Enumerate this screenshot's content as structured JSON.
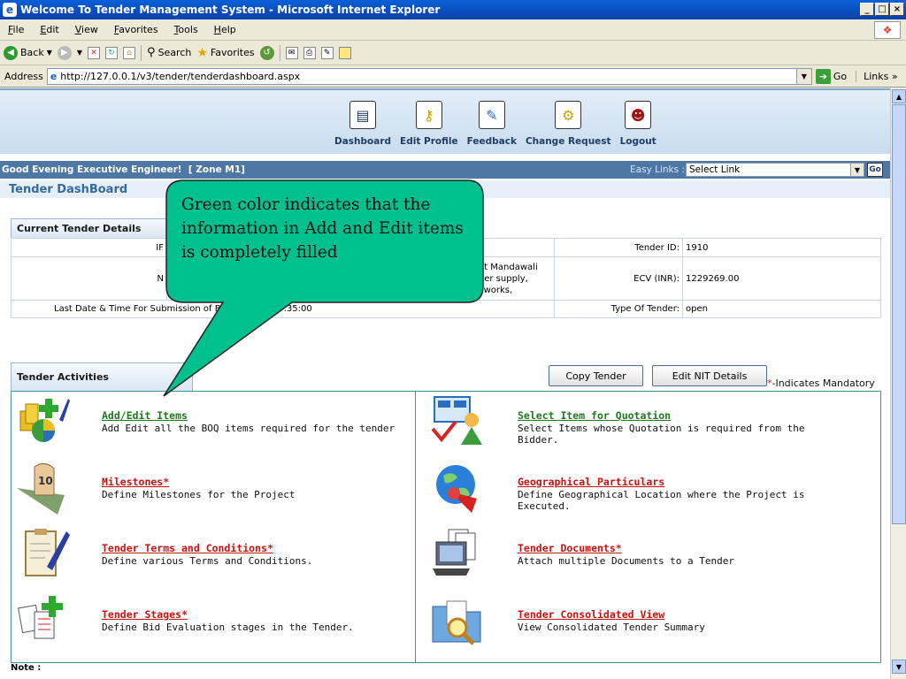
{
  "window": {
    "title": "Welcome To Tender Management System - Microsoft Internet Explorer",
    "controls": [
      "_",
      "□",
      "×"
    ]
  },
  "menu": [
    "File",
    "Edit",
    "View",
    "Favorites",
    "Tools",
    "Help"
  ],
  "toolbar": {
    "back": "Back",
    "search": "Search",
    "favorites": "Favorites"
  },
  "address": {
    "label": "Address",
    "url": "http://127.0.0.1/v3/tender/tenderdashboard.aspx",
    "go": "Go",
    "links": "Links"
  },
  "nav": [
    {
      "label": "Dashboard",
      "icon": "dashboard-icon"
    },
    {
      "label": "Edit Profile",
      "icon": "key-icon"
    },
    {
      "label": "Feedback",
      "icon": "feedback-icon"
    },
    {
      "label": "Change Request",
      "icon": "change-request-icon"
    },
    {
      "label": "Logout",
      "icon": "logout-icon"
    }
  ],
  "greeting": "Good Evening Executive Engineer!  [ Zone M1]",
  "easy_links": {
    "label": "Easy Links :",
    "selected": "Select Link",
    "go": "Go"
  },
  "dashboard_title": "Tender DashBoard",
  "current_details": {
    "heading": "Current Tender Details",
    "row1_left_label": "IF",
    "tender_id_label": "Tender ID:",
    "tender_id": "1910",
    "row2_left_label": "N",
    "row2_value_lines": [
      "ol at Mandawali",
      "water supply,",
      "cal works,"
    ],
    "ecv_label": "ECV (INR):",
    "ecv": "1229269.00",
    "submission_label": "Last Date & Time For Submission of B",
    "submission_value": ":35:00",
    "type_label": "Type Of Tender:",
    "type_value": "open"
  },
  "activities": {
    "heading": "Tender Activities",
    "copy_button": "Copy Tender",
    "edit_nit_button": "Edit NIT Details",
    "mandatory_star": "*",
    "mandatory_text": "-Indicates Mandatory",
    "items": [
      {
        "title": "Add/Edit Items",
        "required": "",
        "desc": "Add Edit all the BOQ items required for the tender",
        "status": "green"
      },
      {
        "title": "Select Item for Quotation",
        "required": "",
        "desc": "Select Items whose Quotation is required from the Bidder.",
        "status": "green"
      },
      {
        "title": "Milestones",
        "required": "*",
        "desc": "Define Milestones for the Project",
        "status": "red"
      },
      {
        "title": "Geographical Particulars",
        "required": "",
        "desc": "Define Geographical Location where the Project is Executed.",
        "status": "red"
      },
      {
        "title": "Tender Terms and Conditions",
        "required": "*",
        "desc": "Define various Terms and Conditions.",
        "status": "red"
      },
      {
        "title": "Tender Documents",
        "required": "*",
        "desc": "Attach multiple Documents to a Tender",
        "status": "red"
      },
      {
        "title": "Tender Stages",
        "required": "*",
        "desc": "Define Bid Evaluation stages in the Tender.",
        "status": "red"
      },
      {
        "title": "Tender Consolidated View",
        "required": "",
        "desc": "View Consolidated Tender Summary",
        "status": "red"
      }
    ]
  },
  "note": "Note :",
  "callout": "Green color indicates that the information in Add and Edit items is completely filled",
  "colors": {
    "callout_fill": "#00c08e",
    "complete": "#1f7a1f",
    "incomplete": "#cc1111",
    "header_bar": "#4f77a6"
  }
}
